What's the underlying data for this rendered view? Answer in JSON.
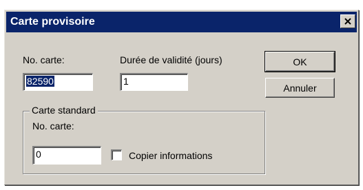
{
  "dialog": {
    "title": "Carte provisoire",
    "close_icon": "close-icon"
  },
  "fields": {
    "card_number_label": "No. carte:",
    "card_number_value": "82590",
    "validity_label": "Durée de validité (jours)",
    "validity_value": "1"
  },
  "buttons": {
    "ok_label": "OK",
    "cancel_label": "Annuler"
  },
  "standard_card": {
    "group_label": "Carte standard",
    "card_number_label": "No. carte:",
    "card_number_value": "0",
    "copy_info_label": "Copier informations",
    "copy_info_checked": false
  },
  "colors": {
    "titlebar": "#0a246a",
    "face": "#d4d0c8",
    "selection": "#0a246a"
  }
}
